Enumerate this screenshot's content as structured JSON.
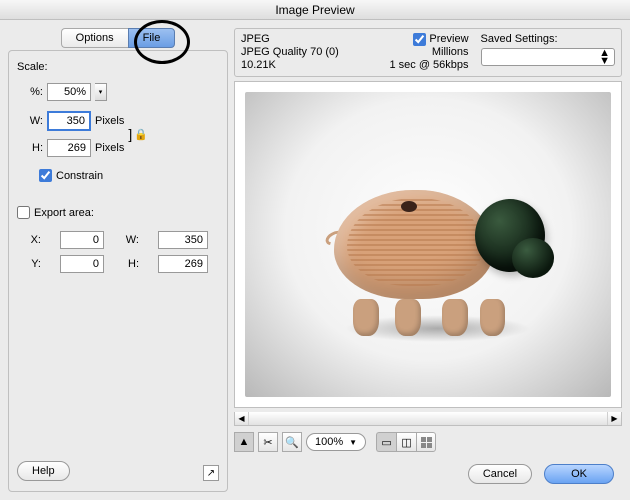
{
  "title": "Image Preview",
  "tabs": {
    "options": "Options",
    "file": "File"
  },
  "scale": {
    "label": "Scale:",
    "percent_label": "%:",
    "percent_value": "50%",
    "w_label": "W:",
    "w_value": "350",
    "w_unit": "Pixels",
    "h_label": "H:",
    "h_value": "269",
    "h_unit": "Pixels",
    "constrain": "Constrain"
  },
  "export": {
    "label": "Export area:",
    "x_label": "X:",
    "x_value": "0",
    "y_label": "Y:",
    "y_value": "0",
    "w_label": "W:",
    "w_value": "350",
    "h_label": "H:",
    "h_value": "269"
  },
  "info": {
    "format": "JPEG",
    "quality": "JPEG Quality 70 (0)",
    "size": "10.21K",
    "preview_label": "Preview",
    "colors": "Millions",
    "time": "1 sec @ 56kbps",
    "saved_label": "Saved Settings:"
  },
  "toolbar": {
    "zoom": "100%"
  },
  "buttons": {
    "help": "Help",
    "cancel": "Cancel",
    "ok": "OK"
  }
}
